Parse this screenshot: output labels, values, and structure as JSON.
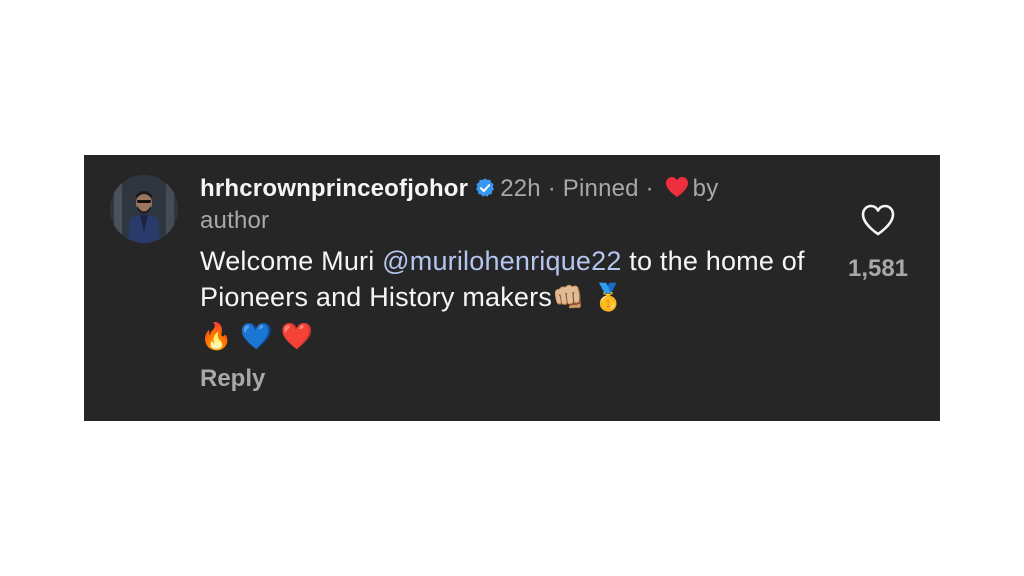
{
  "comment": {
    "username": "hrhcrownprinceofjohor",
    "verified_icon": "verified-badge-icon",
    "time": "22h",
    "separator_1": " · ",
    "pinned": "Pinned",
    "separator_2": " · ",
    "liked_by_prefix": "by",
    "liked_by": "author",
    "text_before_mention": "Welcome Muri ",
    "mention": "@murilohenrique22",
    "text_after_mention": " to the home of Pioneers and History makers",
    "emoji_fist": "👊🏼",
    "emoji_medal": "🥇",
    "emoji_fire": "🔥",
    "emoji_blue_heart": "💙",
    "emoji_red_heart": "❤️",
    "reply_label": "Reply"
  },
  "like": {
    "icon": "heart-outline-icon",
    "count": "1,581"
  },
  "colors": {
    "card_background": "#262626",
    "username": "#f5f5f5",
    "meta": "#a8a8a8",
    "mention": "#b4c6ef",
    "verified": "#3897f0",
    "author_heart": "#ed2f3f"
  }
}
